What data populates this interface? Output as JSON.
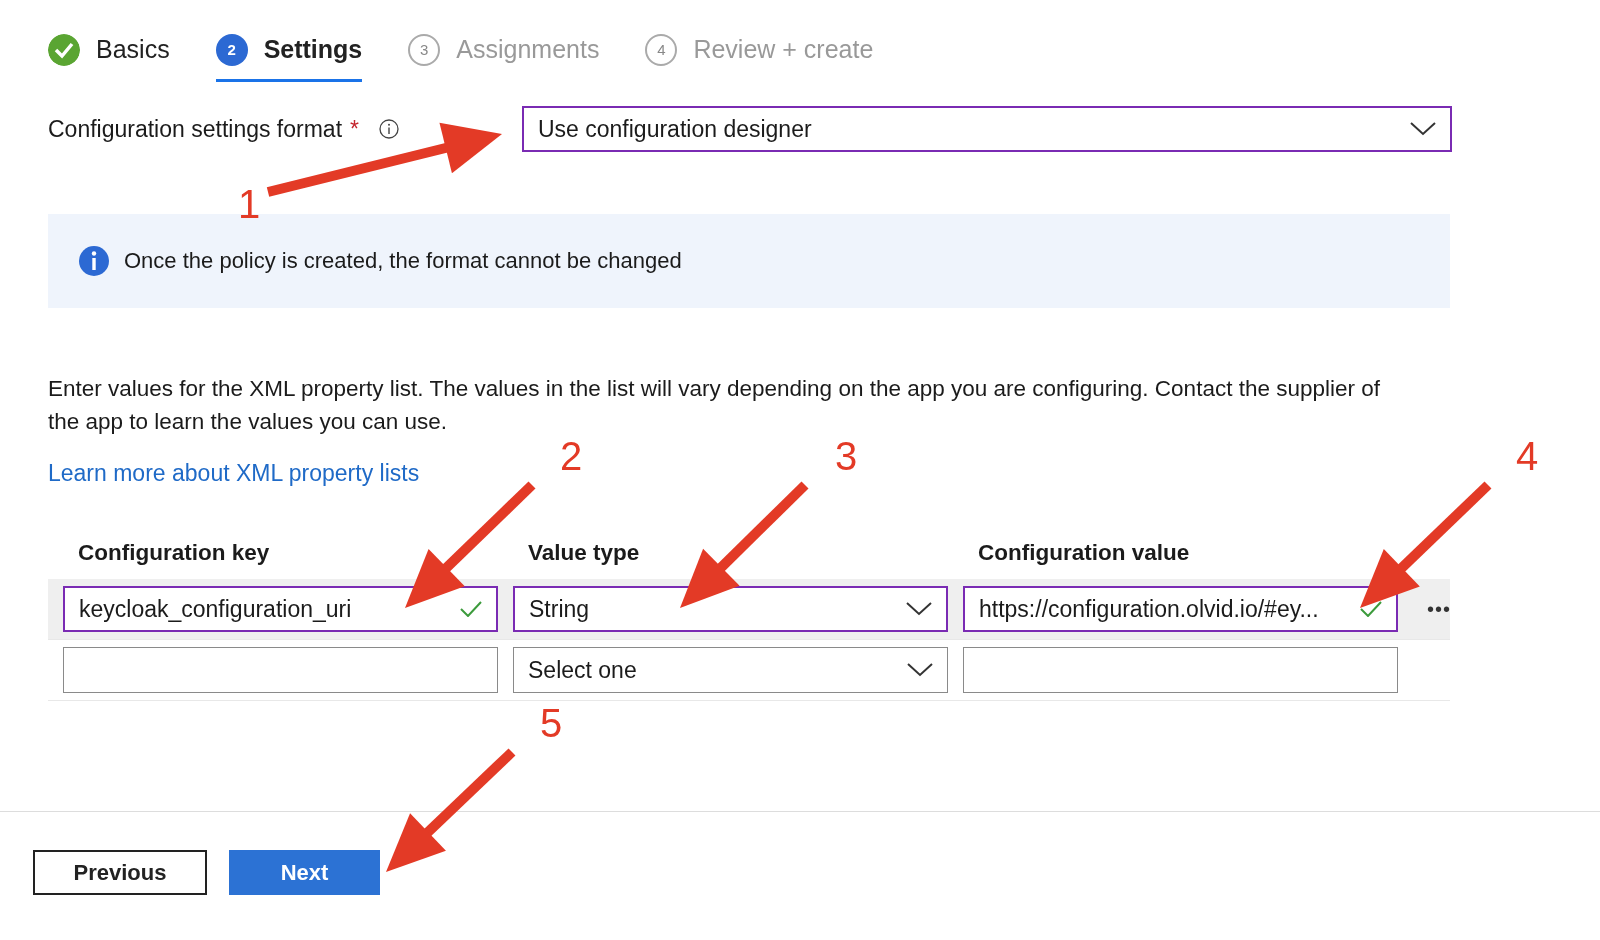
{
  "steps": [
    {
      "label": "Basics",
      "kind": "done",
      "selected": false
    },
    {
      "number": "2",
      "label": "Settings",
      "kind": "current",
      "selected": true
    },
    {
      "number": "3",
      "label": "Assignments",
      "kind": "pending",
      "selected": false
    },
    {
      "number": "4",
      "label": "Review + create",
      "kind": "pending",
      "selected": false
    }
  ],
  "format_field": {
    "label": "Configuration settings format",
    "required_mark": "*",
    "value": "Use configuration designer"
  },
  "info_banner": {
    "text": "Once the policy is created, the format cannot be changed"
  },
  "description": "Enter values for the XML property list. The values in the list will vary depending on the app you are configuring. Contact the supplier of the app to learn the values you can use.",
  "learn_more_link": "Learn more about XML property lists",
  "table": {
    "columns": [
      "Configuration key",
      "Value type",
      "Configuration value"
    ],
    "rows": [
      {
        "selected": true,
        "key": {
          "value": "keycloak_configuration_uri",
          "valid": true
        },
        "type": {
          "value": "String"
        },
        "value": {
          "value": "https://configuration.olvid.io/#ey...",
          "valid": true
        },
        "more": "•••"
      },
      {
        "selected": false,
        "key": {
          "valid": false
        },
        "type": {
          "value": "Select one"
        },
        "value": {
          "valid": false
        }
      }
    ]
  },
  "buttons": [
    {
      "label": "Previous",
      "kind": "secondary"
    },
    {
      "label": "Next",
      "kind": "primary"
    }
  ],
  "annotations": [
    {
      "label": "1"
    },
    {
      "label": "2"
    },
    {
      "label": "3"
    },
    {
      "label": "4"
    },
    {
      "label": "5"
    }
  ]
}
